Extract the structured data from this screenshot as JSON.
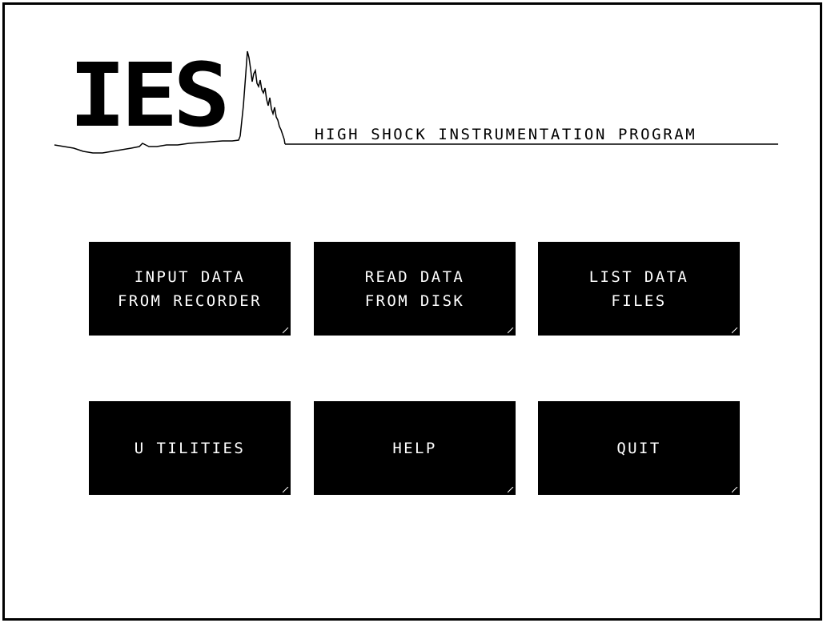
{
  "logo": {
    "text": "IES"
  },
  "header": {
    "title": "HIGH SHOCK INSTRUMENTATION PROGRAM"
  },
  "menu": {
    "buttons": [
      {
        "id": "input-data-from-recorder",
        "label": "INPUT DATA\nFROM RECORDER"
      },
      {
        "id": "read-data-from-disk",
        "label": "READ DATA\nFROM DISK"
      },
      {
        "id": "list-data-files",
        "label": "LIST DATA\nFILES"
      },
      {
        "id": "utilities",
        "label": "U TILITIES"
      },
      {
        "id": "help",
        "label": "HELP"
      },
      {
        "id": "quit",
        "label": "QUIT"
      }
    ]
  },
  "colors": {
    "background": "#ffffff",
    "button_fill": "#000000",
    "button_text": "#ffffff",
    "line": "#000000"
  }
}
